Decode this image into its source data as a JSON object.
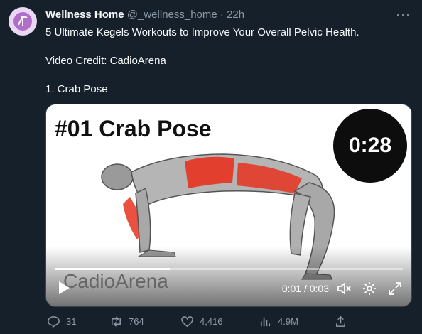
{
  "tweet": {
    "author_name": "Wellness Home",
    "handle": "@_wellness_home",
    "separator": "·",
    "time": "22h",
    "more": "···",
    "lines": {
      "headline": "5 Ultimate Kegels Workouts to Improve Your Overall Pelvic Health.",
      "credit": "Video Credit: CadioArena",
      "item": "1. Crab Pose"
    }
  },
  "video": {
    "overlay_title": "#01 Crab Pose",
    "timer": "0:28",
    "watermark": "CadioArena",
    "current_time": "0:01",
    "time_sep": "/",
    "duration": "0:03",
    "progress": 0.33,
    "muted": true,
    "icons": [
      "play-icon",
      "mute-icon",
      "gear-icon",
      "fullscreen-icon"
    ]
  },
  "actions": {
    "replies": "31",
    "reposts": "764",
    "likes": "4,416",
    "views": "4.9M"
  },
  "colors": {
    "background": "#15202b",
    "muted_text": "#8b98a5",
    "muscle_highlight": "#e8321f"
  }
}
